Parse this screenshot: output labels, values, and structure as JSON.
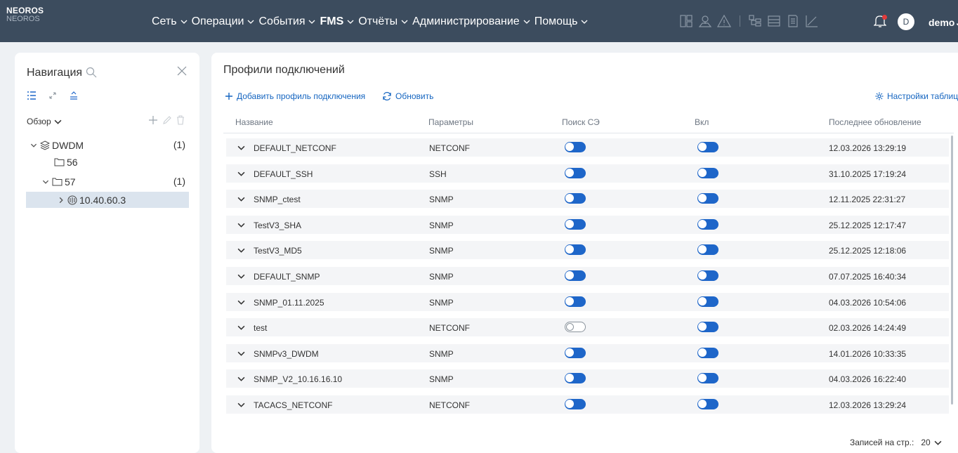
{
  "app": {
    "logo_line1": "NEOROS",
    "logo_line2": "NEOROS"
  },
  "menu": [
    {
      "label": "Сеть"
    },
    {
      "label": "Операции"
    },
    {
      "label": "События"
    },
    {
      "label": "FMS"
    },
    {
      "label": "Отчёты"
    },
    {
      "label": "Администрирование"
    },
    {
      "label": "Помощь"
    }
  ],
  "user": {
    "avatar_letter": "D",
    "name": "demo"
  },
  "navigation": {
    "title": "Навигация",
    "overview_label": "Обзор",
    "tree": [
      {
        "label": "DWDM",
        "count": "(1)"
      },
      {
        "label": "56",
        "count": ""
      },
      {
        "label": "57",
        "count": "(1)"
      },
      {
        "label": "10.40.60.3",
        "count": ""
      }
    ]
  },
  "main": {
    "title": "Профили подключений",
    "add_label": "Добавить профиль подключения",
    "refresh_label": "Обновить",
    "settings_label": "Настройки таблицы",
    "columns": [
      "Название",
      "Параметры",
      "Поиск СЭ",
      "Вкл",
      "Последнее обновление"
    ],
    "rows": [
      {
        "name": "DEFAULT_NETCONF",
        "params": "NETCONF",
        "search": true,
        "enabled": true,
        "updated": "12.03.2026 13:29:19"
      },
      {
        "name": "DEFAULT_SSH",
        "params": "SSH",
        "search": true,
        "enabled": true,
        "updated": "31.10.2025 17:19:24"
      },
      {
        "name": "SNMP_ctest",
        "params": "SNMP",
        "search": true,
        "enabled": true,
        "updated": "12.11.2025 22:31:27"
      },
      {
        "name": "TestV3_SHA",
        "params": "SNMP",
        "search": true,
        "enabled": true,
        "updated": "25.12.2025 12:17:47"
      },
      {
        "name": "TestV3_MD5",
        "params": "SNMP",
        "search": true,
        "enabled": true,
        "updated": "25.12.2025 12:18:06"
      },
      {
        "name": "DEFAULT_SNMP",
        "params": "SNMP",
        "search": true,
        "enabled": true,
        "updated": "07.07.2025 16:40:34"
      },
      {
        "name": "SNMP_01.11.2025",
        "params": "SNMP",
        "search": true,
        "enabled": true,
        "updated": "04.03.2026 10:54:06"
      },
      {
        "name": "test",
        "params": "NETCONF",
        "search": false,
        "enabled": true,
        "updated": "02.03.2026 14:24:49"
      },
      {
        "name": "SNMPv3_DWDM",
        "params": "SNMP",
        "search": true,
        "enabled": true,
        "updated": "14.01.2026 10:33:35"
      },
      {
        "name": "SNMP_V2_10.16.16.10",
        "params": "SNMP",
        "search": true,
        "enabled": true,
        "updated": "04.03.2026 16:22:40"
      },
      {
        "name": "TACACS_NETCONF",
        "params": "NETCONF",
        "search": true,
        "enabled": true,
        "updated": "12.03.2026 13:29:24"
      }
    ],
    "pager": {
      "label": "Записей на стр.:",
      "value": "20"
    }
  },
  "colors": {
    "topbar": "#3c4c5e",
    "accent": "#1e66c9",
    "link": "#1565c0",
    "selected": "#dbe4ee"
  }
}
